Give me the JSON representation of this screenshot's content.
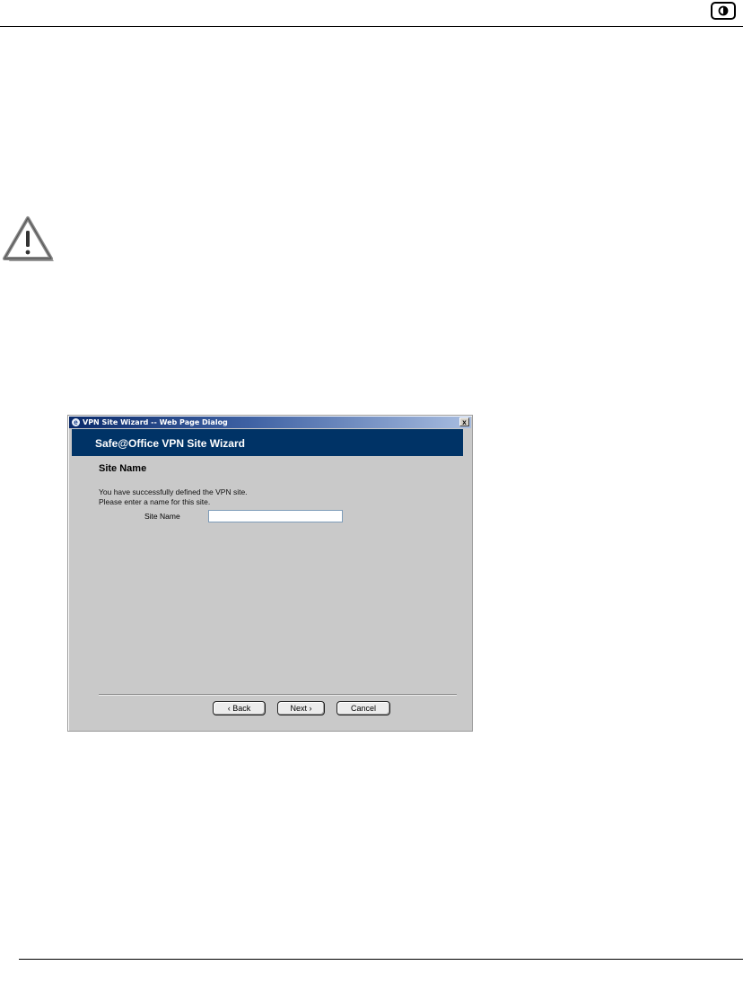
{
  "dialog": {
    "window_title": "VPN Site Wizard -- Web Page Dialog",
    "close_glyph": "x",
    "banner_title": "Safe@Office VPN Site Wizard",
    "section_heading": "Site Name",
    "message_line1": "You have successfully defined the VPN site.",
    "message_line2": "Please enter a name for this site.",
    "site_name_label": "Site Name",
    "site_name_value": "",
    "buttons": {
      "back": "‹ Back",
      "next": "Next ›",
      "cancel": "Cancel"
    }
  },
  "icons": {
    "logo": "checkpoint-logo-icon",
    "warning": "warning-triangle-icon",
    "dialog": "ie-dialog-icon"
  }
}
